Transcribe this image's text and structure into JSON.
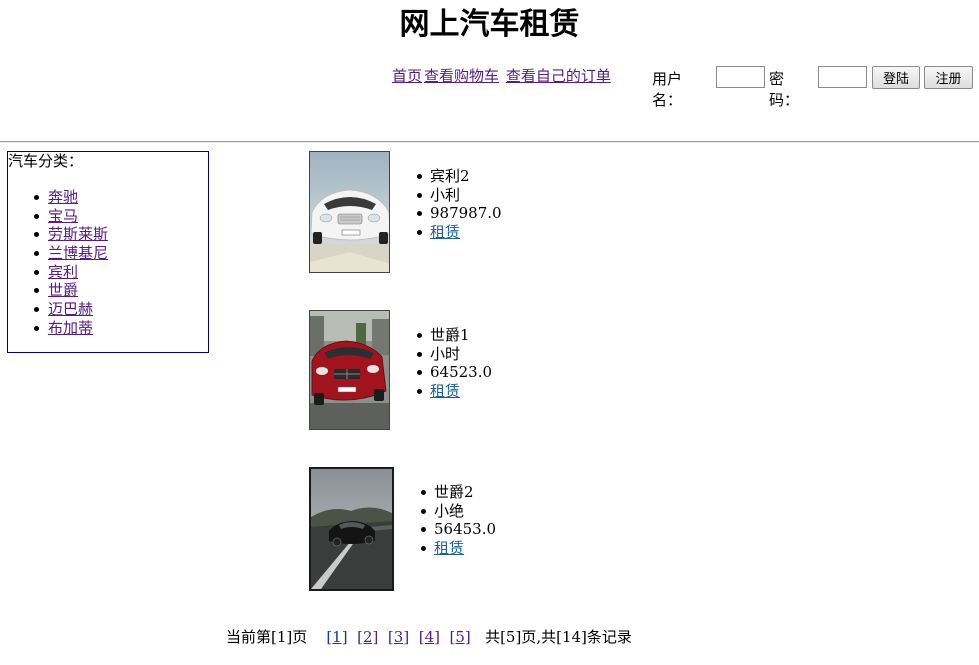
{
  "site": {
    "title": "网上汽车租赁"
  },
  "nav": {
    "home": "首页",
    "cart": "查看购物车",
    "orders": "查看自己的订单"
  },
  "login": {
    "username_label": "用户名：",
    "password_label": "密码：",
    "username_value": "",
    "password_value": "",
    "login_button": "登陆",
    "register_button": "注册"
  },
  "categories": {
    "title": "汽车分类：",
    "items": [
      "奔驰",
      "宝马",
      "劳斯莱斯",
      "兰博基尼",
      "宾利",
      "世爵",
      "迈巴赫",
      "布加蒂"
    ]
  },
  "cars": [
    {
      "name": "宾利2",
      "desc": "小利",
      "price": "987987.0",
      "action": "租赁",
      "image": "white-convertible-photo"
    },
    {
      "name": "世爵1",
      "desc": "小时",
      "price": "64523.0",
      "action": "租赁",
      "image": "red-sedan-photo"
    },
    {
      "name": "世爵2",
      "desc": "小绝",
      "price": "56453.0",
      "action": "租赁",
      "image": "black-car-road-photo"
    }
  ],
  "pager": {
    "prefix": "当前第[1]页",
    "pages": [
      "[1]",
      "[2]",
      "[3]",
      "[4]",
      "[5]"
    ],
    "summary": "共[5]页,共[14]条记录"
  },
  "colors": {
    "visited_link": "#551a8b",
    "link": "#1a5fa0",
    "category_border": "#000080"
  }
}
